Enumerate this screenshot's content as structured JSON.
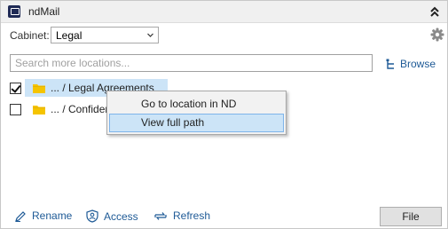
{
  "titlebar": {
    "title": "ndMail",
    "app_icon": "ndmail-logo-icon",
    "collapse_icon": "double-chevron-up-icon"
  },
  "cabinet": {
    "label": "Cabinet:",
    "selected": "Legal",
    "settings_icon": "gear-icon"
  },
  "search": {
    "placeholder": "Search more locations...",
    "value": ""
  },
  "browse": {
    "label": "Browse",
    "icon": "browse-tree-icon"
  },
  "locations": [
    {
      "label": "... / Legal Agreements",
      "checked": true,
      "selected": true,
      "icon": "folder-icon"
    },
    {
      "label": "... / Confider",
      "checked": false,
      "selected": false,
      "icon": "folder-icon"
    }
  ],
  "context_menu": {
    "items": [
      {
        "label": "Go to location in ND",
        "hovered": false
      },
      {
        "label": "View full path",
        "hovered": true
      }
    ]
  },
  "footer": {
    "rename_label": "Rename",
    "access_label": "Access",
    "refresh_label": "Refresh",
    "file_label": "File"
  },
  "colors": {
    "accent_link": "#1e5a96",
    "selection": "#cce4f7",
    "folder": "#f5c400"
  }
}
